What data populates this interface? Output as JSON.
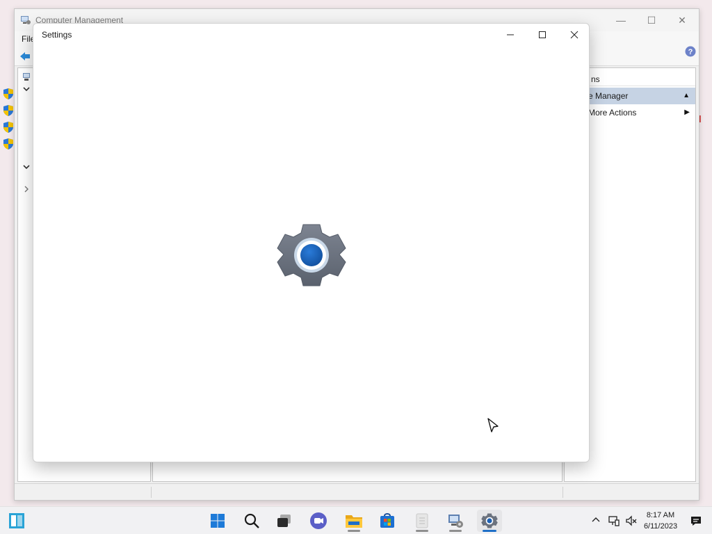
{
  "background_window": {
    "title": "Computer Management",
    "menu": {
      "file": "File"
    },
    "actions_pane": {
      "header": "ns",
      "items": [
        {
          "label": "e Manager",
          "selected": true,
          "indicator": "▲"
        },
        {
          "label": "More Actions",
          "selected": false,
          "indicator": "▶"
        }
      ]
    }
  },
  "settings_window": {
    "title": "Settings",
    "minimize_icon": "minimize-icon",
    "maximize_icon": "maximize-icon",
    "close_icon": "close-icon",
    "splash_icon": "settings-gear-icon",
    "accent_color": "#1e62b4"
  },
  "taskbar": {
    "apps": [
      {
        "name": "widgets-icon"
      },
      {
        "name": "start-icon"
      },
      {
        "name": "search-icon"
      },
      {
        "name": "task-view-icon"
      },
      {
        "name": "teams-chat-icon"
      },
      {
        "name": "file-explorer-icon"
      },
      {
        "name": "store-icon"
      },
      {
        "name": "notepad-icon"
      },
      {
        "name": "computer-management-icon"
      },
      {
        "name": "settings-icon",
        "active": true
      }
    ],
    "clock": {
      "time": "8:17 AM",
      "date": "6/11/2023"
    }
  }
}
